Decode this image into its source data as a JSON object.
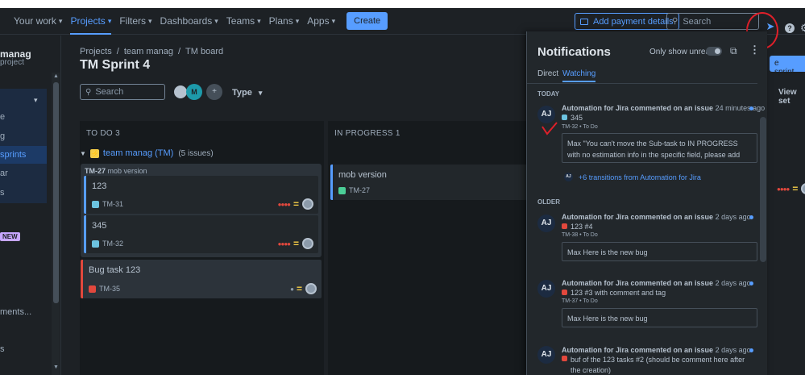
{
  "nav": {
    "items": [
      {
        "label": "Your work"
      },
      {
        "label": "Projects"
      },
      {
        "label": "Filters"
      },
      {
        "label": "Dashboards"
      },
      {
        "label": "Teams"
      },
      {
        "label": "Plans"
      },
      {
        "label": "Apps"
      }
    ],
    "create_label": "Create",
    "add_payment_label": "Add payment details",
    "search_placeholder": "Search",
    "help_label": "?"
  },
  "sidebar": {
    "project_name": "manag",
    "project_sub": "project",
    "items": [
      {
        "label": "e"
      },
      {
        "label": "g"
      },
      {
        "label": "sprints"
      },
      {
        "label": "ar"
      },
      {
        "label": "s"
      },
      {
        "label": "NEW"
      },
      {
        "label": "ments..."
      },
      {
        "label": "s"
      }
    ]
  },
  "board": {
    "breadcrumbs": [
      "Projects",
      "team manag",
      "TM board"
    ],
    "title": "TM Sprint 4",
    "search_placeholder": "Search",
    "avatar_initial": "M",
    "type_filter": "Type",
    "columns": [
      {
        "header": "TO DO 3"
      },
      {
        "header": "IN PROGRESS 1"
      }
    ],
    "swimlane": {
      "label": "team manag (TM)",
      "count": "(5 issues)"
    },
    "parent": {
      "key": "TM-27",
      "summary": "mob version"
    },
    "todo_cards": [
      {
        "title": "123",
        "key": "TM-31"
      },
      {
        "title": "345",
        "key": "TM-32"
      },
      {
        "title": "Bug task 123",
        "key": "TM-35"
      }
    ],
    "progress_card": {
      "title": "mob version",
      "key": "TM-27"
    },
    "start_sprint_label": "e sprint",
    "view_settings_label": "View set"
  },
  "notifications": {
    "title": "Notifications",
    "unread_label": "Only show unread",
    "tabs": [
      {
        "label": "Direct"
      },
      {
        "label": "Watching"
      }
    ],
    "today_label": "TODAY",
    "older_label": "OLDER",
    "items": [
      {
        "avatar": "AJ",
        "actor": "Automation for Jira",
        "action": "commented on an issue",
        "time": "24 minutes ago",
        "issue": "345",
        "sub": "TM-32 • To Do",
        "comment": "Max \"You can't move the Sub-task to IN PROGRESS with no estimation info in the specific field, please add the estimation to...",
        "transitions": "+6 transitions from Automation for Jira"
      },
      {
        "avatar": "AJ",
        "actor": "Automation for Jira",
        "action": "commented on an issue",
        "time": "2 days ago",
        "issue": "123 #4",
        "sub": "TM-38 • To Do",
        "comment": "Max Here is the new bug"
      },
      {
        "avatar": "AJ",
        "actor": "Automation for Jira",
        "action": "commented on an issue",
        "time": "2 days ago",
        "issue": "123 #3 with comment and tag",
        "sub": "TM-37 • To Do",
        "comment": "Max Here is the new bug"
      },
      {
        "avatar": "AJ",
        "actor": "Automation for Jira",
        "action": "commented on an issue",
        "time": "2 days ago",
        "issue": "buf of the 123 tasks #2 (should be comment here after the creation)"
      }
    ],
    "mini_avatar": "AJ"
  },
  "colors": {
    "accent": "#579dff",
    "bug": "#e2483d",
    "annotation_red": "#e0202a"
  }
}
